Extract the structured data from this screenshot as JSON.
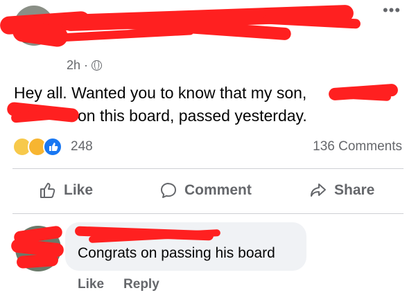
{
  "header": {
    "timestamp": "2h",
    "separator": "·",
    "more_label": "•••",
    "privacy_icon": "globe-icon"
  },
  "post": {
    "line1": "Hey all.  Wanted you to know that my son,",
    "line2": "on this board, passed yesterday."
  },
  "reactions": {
    "icons": [
      "sad-icon",
      "care-icon",
      "like-icon"
    ],
    "count": "248",
    "comments_count": "136 Comments"
  },
  "actions": {
    "like": "Like",
    "comment": "Comment",
    "share": "Share"
  },
  "comment": {
    "text": "Congrats on passing his board",
    "like": "Like",
    "reply": "Reply"
  },
  "colors": {
    "secondary_text": "#65676b",
    "bubble": "#f0f2f5",
    "like_blue": "#1877f2",
    "redaction": "#ff2020"
  }
}
